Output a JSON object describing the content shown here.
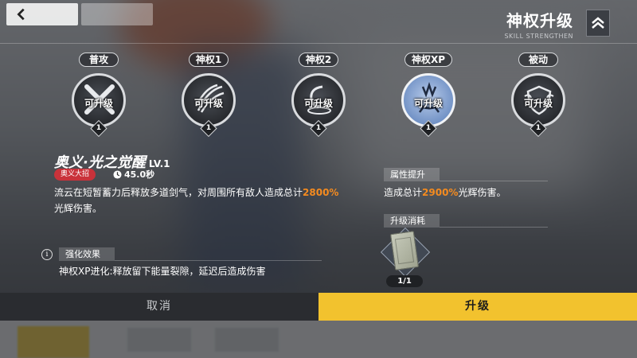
{
  "header": {
    "title": "神权升级",
    "subtitle": "SKILL STRENGTHEN"
  },
  "skills": [
    {
      "tab": "普攻",
      "status": "可升级",
      "level": "1",
      "icon": "crossed-swords-icon"
    },
    {
      "tab": "神权1",
      "status": "可升级",
      "level": "1",
      "icon": "feather-slash-icon"
    },
    {
      "tab": "神权2",
      "status": "可升级",
      "level": "1",
      "icon": "vortex-icon"
    },
    {
      "tab": "神权XP",
      "status": "可升级",
      "level": "1",
      "icon": "crown-burst-icon",
      "selected": true
    },
    {
      "tab": "被动",
      "status": "可升级",
      "level": "1",
      "icon": "shield-crest-icon"
    }
  ],
  "detail": {
    "name": "奥义·光之觉醒",
    "level": "LV.1",
    "tag": "奥义大招",
    "cooldown": "45.0秒",
    "desc_1": "流云在短暂蓄力后释放多道剑气，对周围所有敌人造成总计",
    "desc_hl": "2800%",
    "desc_2": "光辉伤害。",
    "enhance_title": "强化效果",
    "enhance_desc": "神权XP进化:释放留下能量裂隙，延迟后造成伤害"
  },
  "attributes": {
    "title": "属性提升",
    "desc_1": "造成总计",
    "desc_hl": "2900%",
    "desc_2": "光辉伤害。"
  },
  "cost": {
    "title": "升级消耗",
    "item_icon": "skill-book-icon",
    "count": "1/1"
  },
  "buttons": {
    "cancel": "取消",
    "upgrade": "升级"
  },
  "colors": {
    "accent_yellow": "#f2c22e",
    "highlight_orange": "#f58b1f",
    "tag_red": "#c9323a",
    "selected_skill": "#8fa9d6"
  }
}
